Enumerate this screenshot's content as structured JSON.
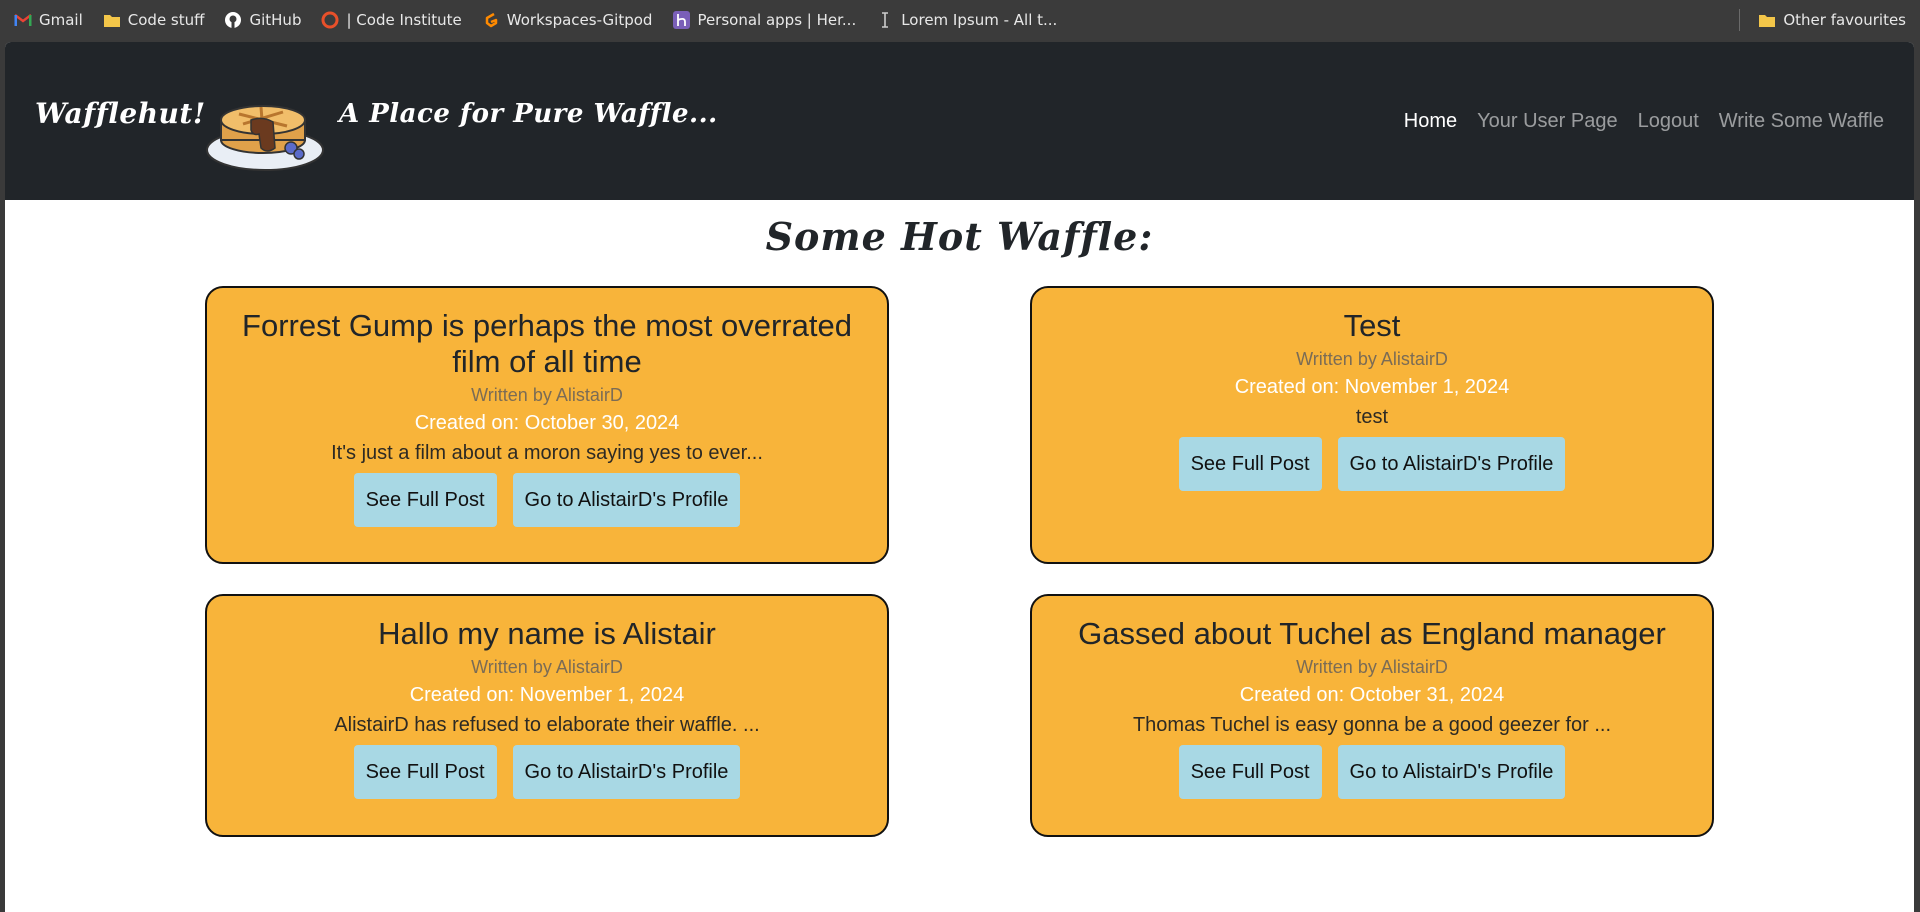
{
  "bookmarks": {
    "items": [
      {
        "label": "Gmail",
        "icon": "gmail-icon"
      },
      {
        "label": "Code stuff",
        "icon": "folder-icon"
      },
      {
        "label": "GitHub",
        "icon": "github-icon"
      },
      {
        "label": "| Code Institute",
        "icon": "code-institute-icon"
      },
      {
        "label": "Workspaces-Gitpod",
        "icon": "gitpod-icon"
      },
      {
        "label": "Personal apps | Her...",
        "icon": "heroku-icon"
      },
      {
        "label": "Lorem Ipsum - All t...",
        "icon": "text-cursor-icon"
      }
    ],
    "other": "Other favourites"
  },
  "navbar": {
    "brand": "Wafflehut!",
    "tagline": "A Place for Pure Waffle...",
    "links": [
      "Home",
      "Your User Page",
      "Logout",
      "Write Some Waffle"
    ],
    "active_link": "Home"
  },
  "main": {
    "title": "Some Hot Waffle:"
  },
  "posts": [
    {
      "title": "Forrest Gump is perhaps the most overrated film of all time",
      "author": "Written by AlistairD",
      "date": "Created on: October 30, 2024",
      "excerpt": "It's just a film about a moron saying yes to ever...",
      "see_full": "See Full Post",
      "profile": "Go to AlistairD's Profile"
    },
    {
      "title": "Test",
      "author": "Written by AlistairD",
      "date": "Created on: November 1, 2024",
      "excerpt": "test",
      "see_full": "See Full Post",
      "profile": "Go to AlistairD's Profile"
    },
    {
      "title": "Hallo my name is Alistair",
      "author": "Written by AlistairD",
      "date": "Created on: November 1, 2024",
      "excerpt": "AlistairD has refused to elaborate their waffle. ...",
      "see_full": "See Full Post",
      "profile": "Go to AlistairD's Profile"
    },
    {
      "title": "Gassed about Tuchel as England manager",
      "author": "Written by AlistairD",
      "date": "Created on: October 31, 2024",
      "excerpt": "Thomas Tuchel is easy gonna be a good geezer for ...",
      "see_full": "See Full Post",
      "profile": "Go to AlistairD's Profile"
    }
  ],
  "colors": {
    "navbar": "#212529",
    "card": "#f8b43a",
    "button": "#a8d8e4"
  }
}
